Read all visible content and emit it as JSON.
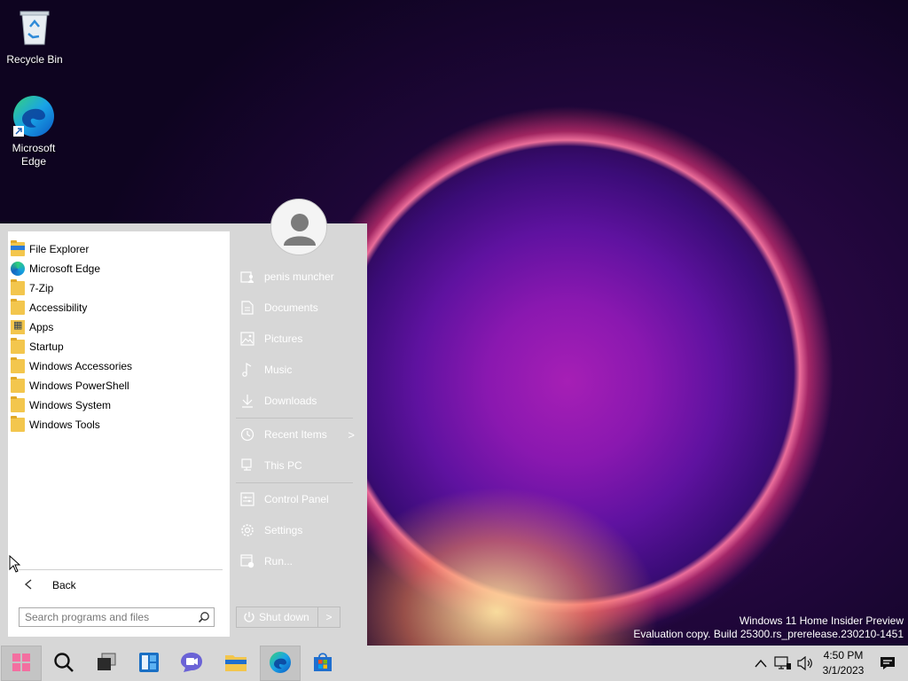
{
  "desktop": {
    "icons": [
      {
        "label": "Recycle Bin",
        "icon": "recycle-bin-icon"
      },
      {
        "label": "Microsoft Edge",
        "icon": "edge-icon"
      }
    ]
  },
  "start_menu": {
    "programs": [
      {
        "label": "File Explorer",
        "icon": "file-explorer-icon"
      },
      {
        "label": "Microsoft Edge",
        "icon": "edge-icon"
      },
      {
        "label": "7-Zip",
        "icon": "folder-icon"
      },
      {
        "label": "Accessibility",
        "icon": "folder-icon"
      },
      {
        "label": "Apps",
        "icon": "apps-folder-icon"
      },
      {
        "label": "Startup",
        "icon": "folder-icon"
      },
      {
        "label": "Windows Accessories",
        "icon": "folder-icon"
      },
      {
        "label": "Windows PowerShell",
        "icon": "folder-icon"
      },
      {
        "label": "Windows System",
        "icon": "folder-icon"
      },
      {
        "label": "Windows Tools",
        "icon": "folder-icon"
      }
    ],
    "back_label": "Back",
    "search_placeholder": "Search programs and files",
    "side_items": [
      {
        "label": "penis muncher",
        "icon": "user-folder-icon"
      },
      {
        "label": "Documents",
        "icon": "document-icon"
      },
      {
        "label": "Pictures",
        "icon": "picture-icon"
      },
      {
        "label": "Music",
        "icon": "music-icon"
      },
      {
        "label": "Downloads",
        "icon": "download-icon"
      },
      {
        "label": "Recent Items",
        "icon": "clock-icon"
      },
      {
        "label": "This PC",
        "icon": "computer-icon"
      },
      {
        "label": "Control Panel",
        "icon": "control-panel-icon"
      },
      {
        "label": "Settings",
        "icon": "gear-icon"
      },
      {
        "label": "Run...",
        "icon": "run-icon"
      }
    ],
    "shutdown_label": "Shut down",
    "submenu_arrow": ">"
  },
  "watermark": {
    "line1": "Windows 11 Home Insider Preview",
    "line2": "Evaluation copy. Build 25300.rs_prerelease.230210-1451"
  },
  "taskbar": {
    "apps": [
      {
        "name": "start-button",
        "icon": "windows-logo-icon"
      },
      {
        "name": "search-button",
        "icon": "search-icon"
      },
      {
        "name": "task-view-button",
        "icon": "task-view-icon"
      },
      {
        "name": "widgets-button",
        "icon": "widgets-icon"
      },
      {
        "name": "chat-button",
        "icon": "teams-chat-icon"
      },
      {
        "name": "file-explorer-button",
        "icon": "file-explorer-icon"
      },
      {
        "name": "edge-button",
        "icon": "edge-icon"
      },
      {
        "name": "store-button",
        "icon": "microsoft-store-icon"
      }
    ],
    "clock_time": "4:50 PM",
    "clock_date": "3/1/2023",
    "colors": {
      "taskbar_bg": "#d7d7d7",
      "menu_bg": "#d7d7d7",
      "accent_blue": "#0078d4"
    }
  }
}
